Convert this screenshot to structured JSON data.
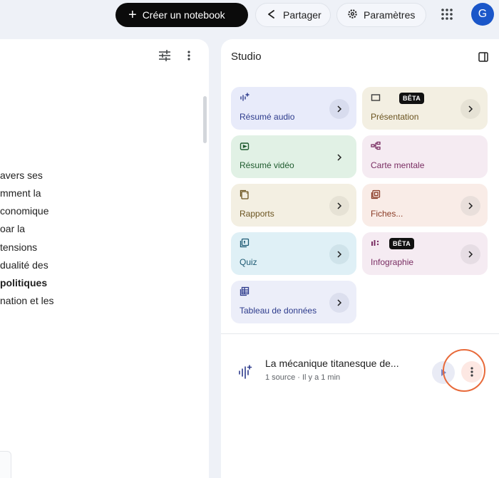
{
  "header": {
    "create_label": "Créer un notebook",
    "share_label": "Partager",
    "settings_label": "Paramètres",
    "avatar_initial": "G"
  },
  "left_panel": {
    "text_fragments": [
      "avers ses",
      "mment la",
      "conomique",
      "oar la",
      "tensions",
      "dualité des",
      "politiques",
      "nation et les"
    ]
  },
  "studio": {
    "title": "Studio",
    "tiles": [
      {
        "id": "audio",
        "label": "Résumé audio",
        "icon": "audio-waveform-icon"
      },
      {
        "id": "presentation",
        "label": "Présentation",
        "badge": "BÊTA",
        "icon": "slides-icon"
      },
      {
        "id": "video",
        "label": "Résumé vidéo",
        "icon": "video-icon"
      },
      {
        "id": "mindmap",
        "label": "Carte mentale",
        "icon": "mindmap-icon"
      },
      {
        "id": "reports",
        "label": "Rapports",
        "icon": "reports-icon"
      },
      {
        "id": "flashcards",
        "label": "Fiches...",
        "icon": "flashcards-icon"
      },
      {
        "id": "quiz",
        "label": "Quiz",
        "icon": "quiz-icon"
      },
      {
        "id": "infographic",
        "label": "Infographie",
        "badge": "BÊTA",
        "icon": "infographic-icon"
      },
      {
        "id": "datatable",
        "label": "Tableau de données",
        "icon": "table-icon"
      }
    ],
    "output": {
      "title": "La mécanique titanesque de...",
      "meta": "1 source · Il y a 1 min"
    }
  },
  "colors": {
    "accent_highlight": "#e86a3a",
    "avatar_bg": "#1a56c9"
  }
}
